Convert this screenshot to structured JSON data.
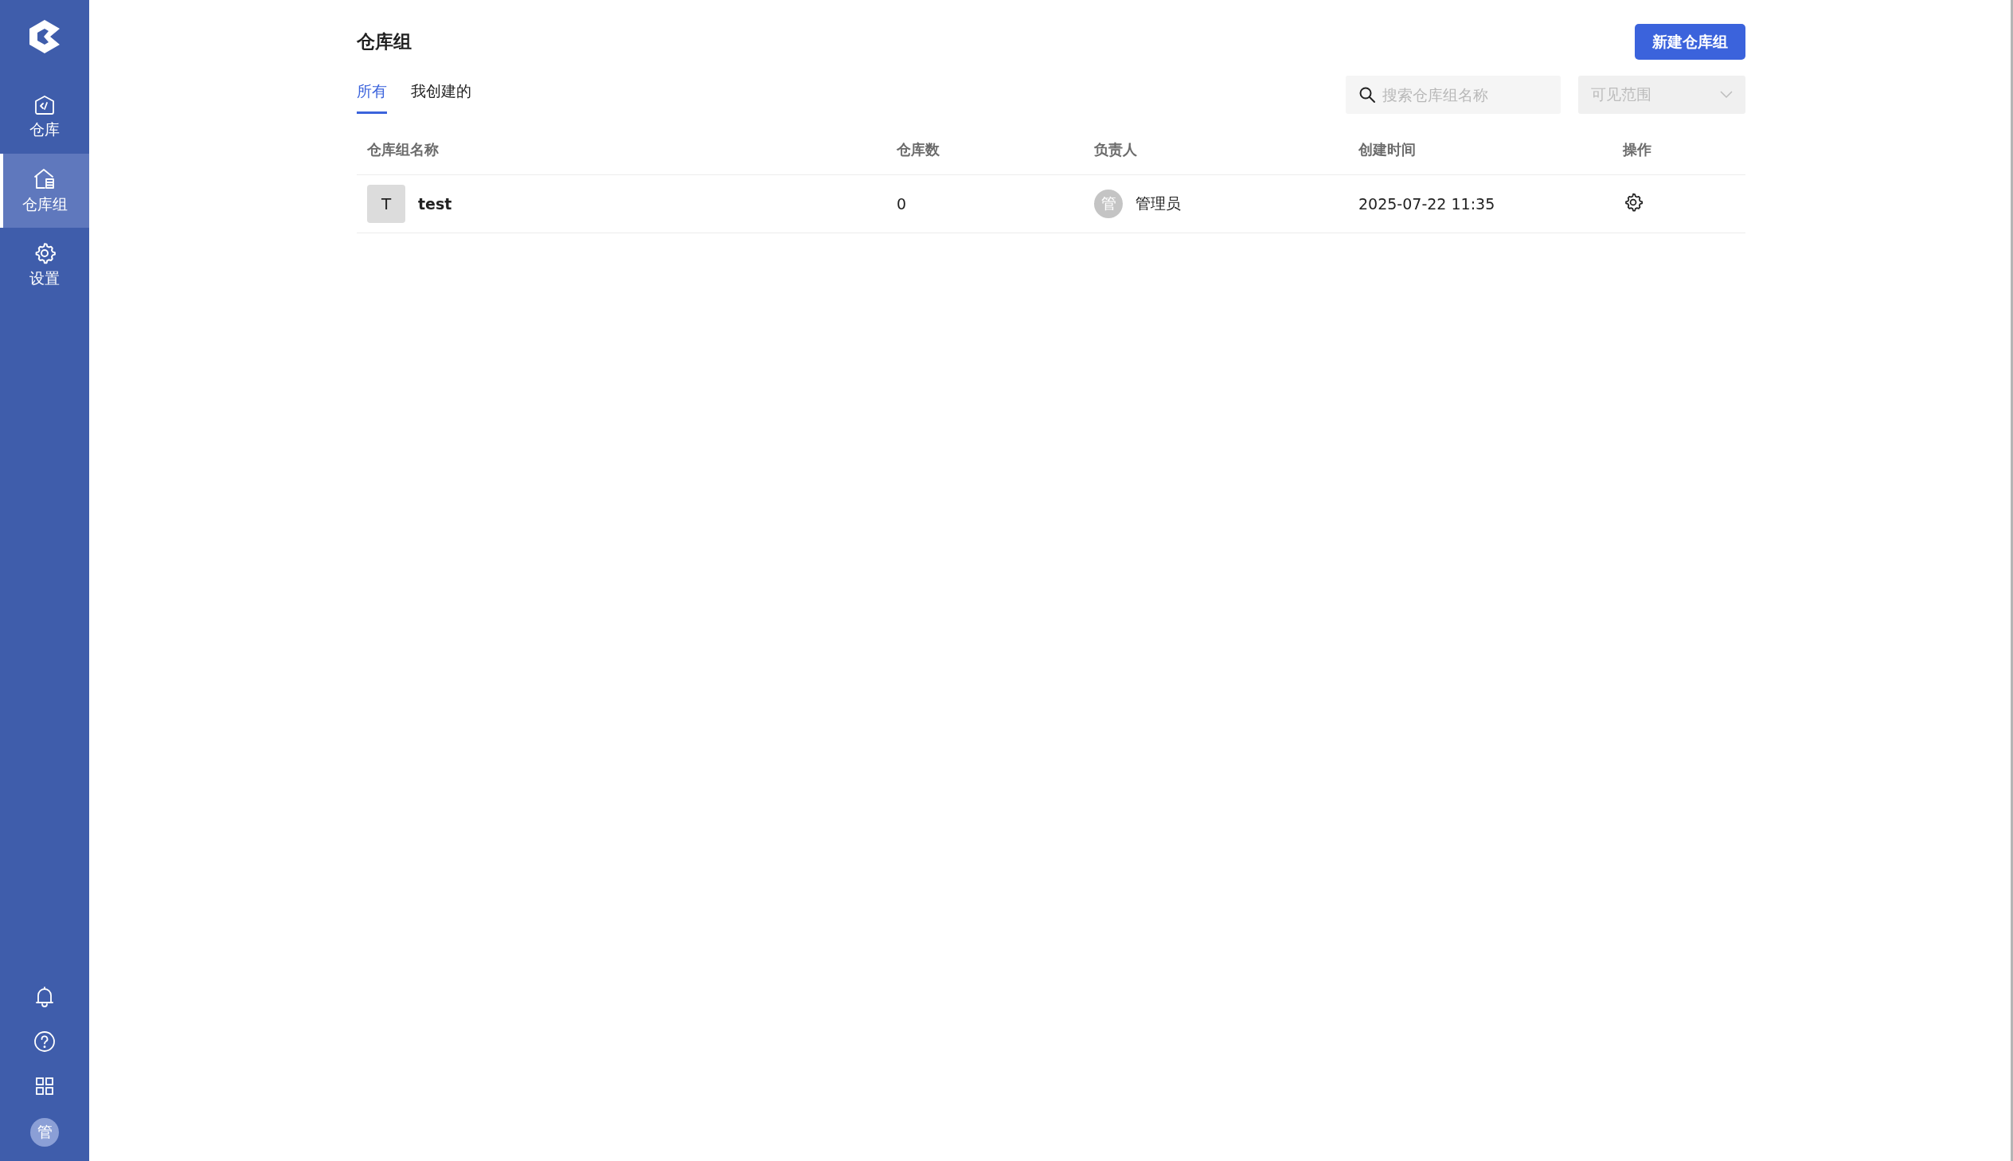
{
  "sidebar": {
    "nav_items": [
      {
        "kind": "repo",
        "label": "仓库",
        "selected": false
      },
      {
        "kind": "group",
        "label": "仓库组",
        "selected": true
      },
      {
        "kind": "settings",
        "label": "设置",
        "selected": false
      }
    ],
    "avatar": "管"
  },
  "page": {
    "title": "仓库组",
    "create_button": "新建仓库组"
  },
  "tabs": [
    {
      "label": "所有",
      "selected": true
    },
    {
      "label": "我创建的",
      "selected": false
    }
  ],
  "search": {
    "placeholder": "搜索仓库组名称"
  },
  "visibility_select": {
    "placeholder": "可见范围"
  },
  "table": {
    "columns": [
      "仓库组名称",
      "仓库数",
      "负责人",
      "创建时间",
      "操作"
    ],
    "rows": [
      {
        "initial": "T",
        "name": "test",
        "count": "0",
        "owner_avatar": "管",
        "owner": "管理员",
        "created": "2025-07-22 11:35"
      }
    ]
  }
}
